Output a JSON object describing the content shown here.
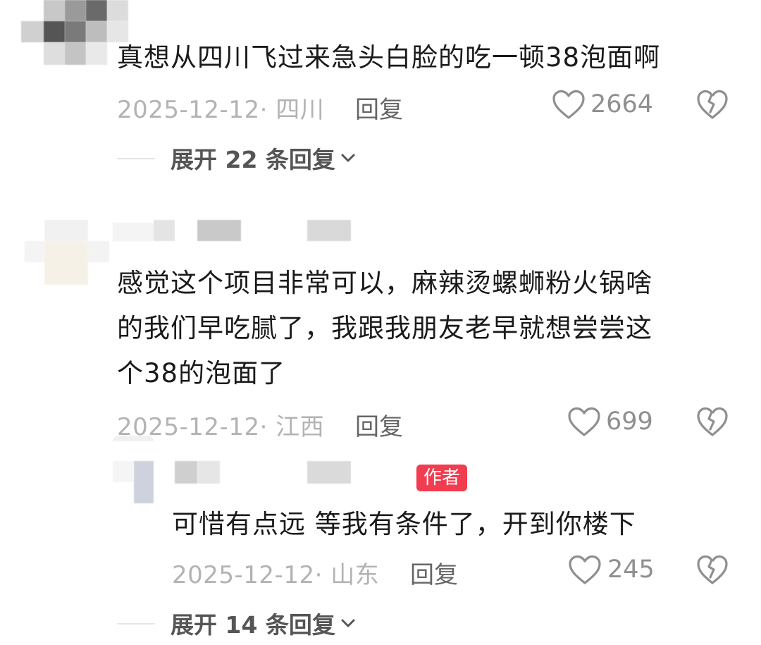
{
  "comments": [
    {
      "text": "真想从四川飞过来急头白脸的吃一顿38泡面啊",
      "date_location": "2025-12-12· 四川",
      "reply_label": "回复",
      "likes": "2664",
      "expand_label": "展开 22 条回复"
    },
    {
      "text_lines": [
        "感觉这个项目非常可以，麻辣烫螺蛳粉火锅啥",
        "的我们早吃腻了，我跟我朋友老早就想尝尝这",
        "个38的泡面了"
      ],
      "date_location": "2025-12-12· 江西",
      "reply_label": "回复",
      "likes": "699",
      "reply": {
        "badge": "作者",
        "text": "可惜有点远 等我有条件了，开到你楼下",
        "date_location": "2025-12-12· 山东",
        "reply_label": "回复",
        "likes": "245"
      },
      "expand_label": "展开 14 条回复"
    }
  ],
  "colors": {
    "badge": "#f23c4f",
    "meta": "#b3b3b3",
    "icon": "#8f8f8f"
  },
  "icons": [
    "heart-icon",
    "broken-heart-icon",
    "chevron-down-icon"
  ]
}
